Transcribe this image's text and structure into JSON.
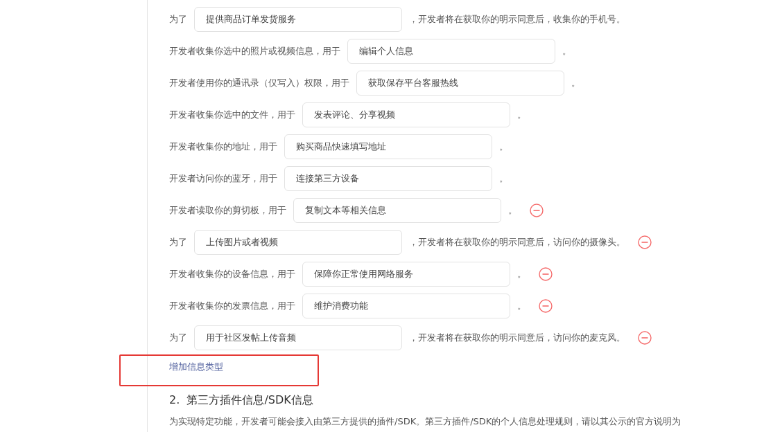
{
  "rows": [
    {
      "label": "为了",
      "value": "提供商品订单发货服务",
      "suffix": "，开发者将在获取你的明示同意后，收集你的手机号。",
      "removable": false
    },
    {
      "label": "开发者收集你选中的照片或视频信息，用于",
      "value": "编辑个人信息",
      "suffix": "。",
      "removable": false
    },
    {
      "label": "开发者使用你的通讯录（仅写入）权限，用于",
      "value": "获取保存平台客服热线",
      "suffix": "。",
      "removable": false
    },
    {
      "label": "开发者收集你选中的文件，用于",
      "value": "发表评论、分享视频",
      "suffix": "。",
      "removable": false
    },
    {
      "label": "开发者收集你的地址，用于",
      "value": "购买商品快速填写地址",
      "suffix": "。",
      "removable": false
    },
    {
      "label": "开发者访问你的蓝牙，用于",
      "value": "连接第三方设备",
      "suffix": "。",
      "removable": false
    },
    {
      "label": "开发者读取你的剪切板，用于",
      "value": "复制文本等相关信息",
      "suffix": "。",
      "removable": true
    },
    {
      "label": "为了",
      "value": "上传图片或者视频",
      "suffix": "，开发者将在获取你的明示同意后，访问你的摄像头。",
      "removable": true
    },
    {
      "label": "开发者收集你的设备信息，用于",
      "value": "保障你正常使用网络服务",
      "suffix": "。",
      "removable": true
    },
    {
      "label": "开发者收集你的发票信息，用于",
      "value": "维护消费功能",
      "suffix": "。",
      "removable": true
    },
    {
      "label": "为了",
      "value": "用于社区发帖上传音频",
      "suffix": "，开发者将在获取你的明示同意后，访问你的麦克风。",
      "removable": true
    }
  ],
  "add_link": {
    "label": "增加信息类型",
    "highlighted": true
  },
  "section": {
    "heading": "2.  第三方插件信息/SDK信息",
    "text": "为实现特定功能，开发者可能会接入由第三方提供的插件/SDK。第三方插件/SDK的个人信息处理规则，请以其公示的官方说明为"
  }
}
